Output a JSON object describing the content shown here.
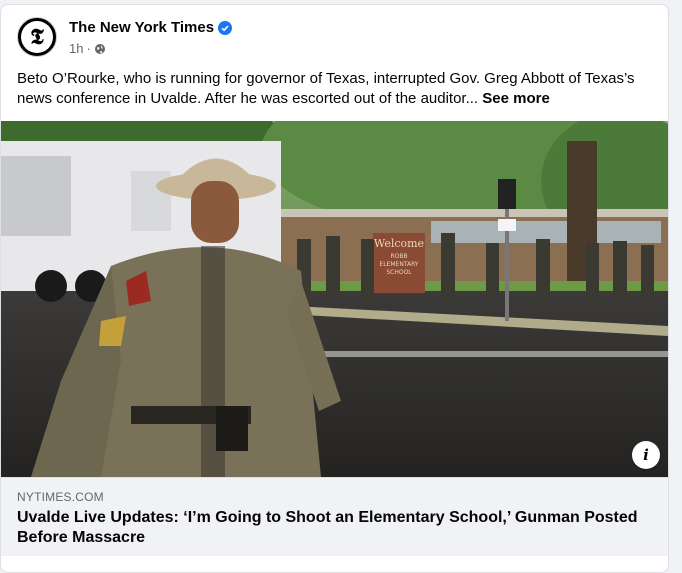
{
  "post": {
    "author": "The New York Times",
    "time": "1h",
    "separator": "·",
    "text": "Beto O’Rourke, who is running for governor of Texas, interrupted Gov. Greg Abbott of Texas’s news conference in Uvalde. After he was escorted out of the auditor...",
    "see_more": "See more"
  },
  "photo": {
    "school_sign": [
      "Welcome",
      "ROBB",
      "ELEMENTARY",
      "SCHOOL"
    ],
    "info_label": "i"
  },
  "link": {
    "domain": "NYTIMES.COM",
    "title": "Uvalde Live Updates: ‘I’m Going to Shoot an Elementary School,’ Gunman Posted Before Massacre"
  },
  "icons": [
    "nyt-logo-icon",
    "verified-badge-icon",
    "globe-icon",
    "info-icon"
  ],
  "colors": {
    "verified": "#1877f2",
    "secondary_text": "#65676b"
  }
}
